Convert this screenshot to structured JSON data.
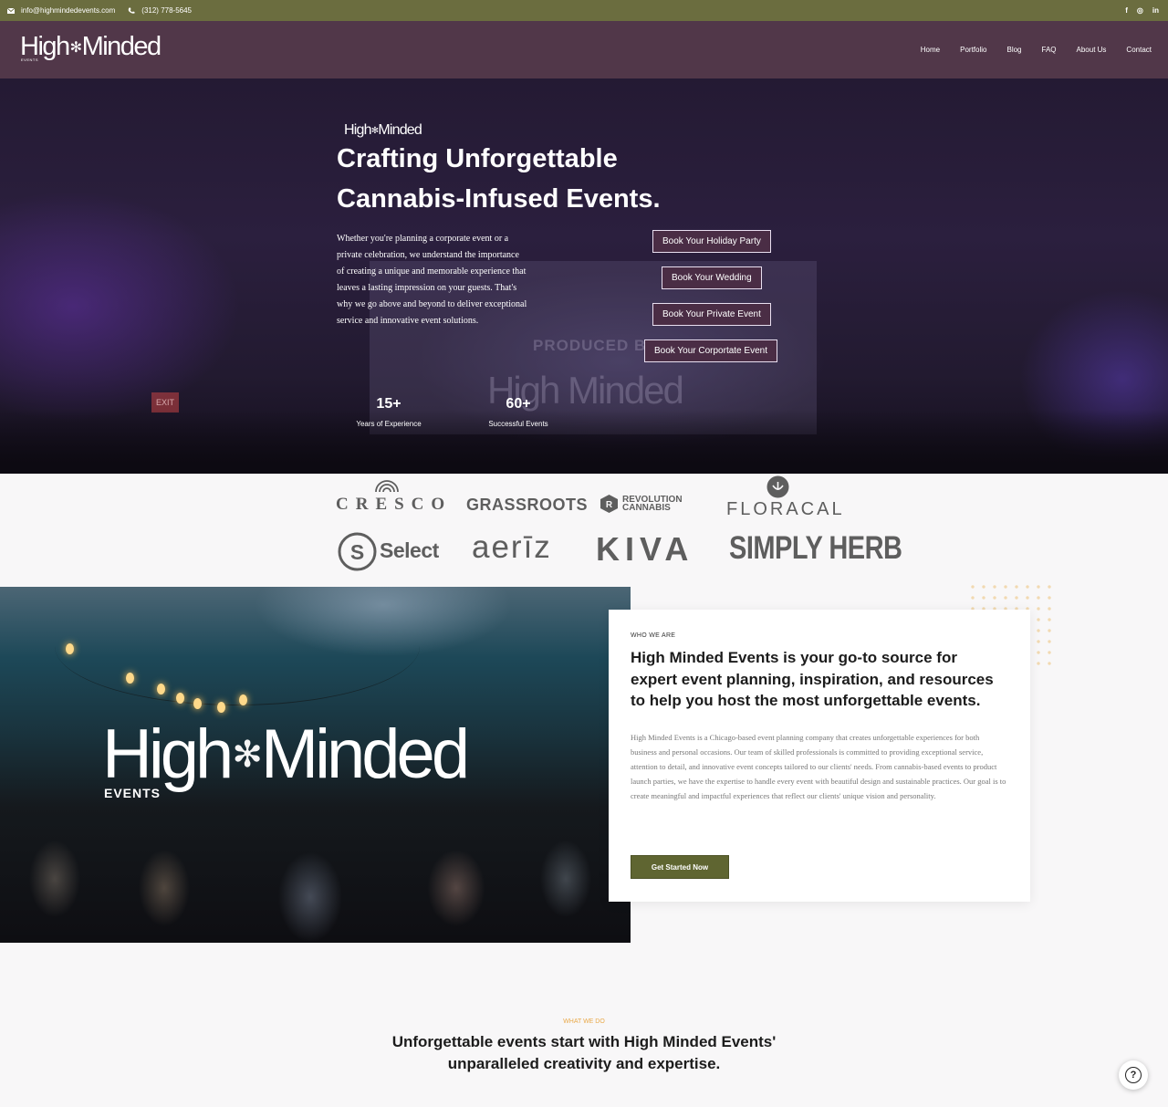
{
  "topbar": {
    "email": "info@highmindedevents.com",
    "phone": "(312) 778-5645",
    "social": [
      "f",
      "◎",
      "in"
    ]
  },
  "header": {
    "logo_text_left": "High",
    "logo_text_right": "Minded",
    "logo_sub": "EVENTS",
    "nav": [
      "Home",
      "Portfolio",
      "Blog",
      "FAQ",
      "About Us",
      "Contact"
    ]
  },
  "hero": {
    "logo_left": "High",
    "logo_right": "Minded",
    "title": "Crafting Unforgettable Cannabis-Infused Events.",
    "description": "Whether you're planning a corporate event or a private celebration, we understand the importance of creating a unique and memorable experience that leaves a lasting impression on your guests. That's why we go above and beyond to deliver exceptional service and innovative event solutions.",
    "buttons": [
      "Book Your Holiday Party",
      "Book Your Wedding",
      "Book Your Private Event",
      "Book Your Corportate Event"
    ],
    "stats": [
      {
        "value": "15+",
        "label": "Years of Experience"
      },
      {
        "value": "60+",
        "label": "Successful Events"
      }
    ],
    "background_text_1": "PRODUCED B",
    "background_text_2": "High Minded",
    "exit_sign": "EXIT"
  },
  "brands": [
    "CRESCO",
    "GRASSROOTS",
    "REVOLUTION",
    "CANNABIS",
    "FLORACAL",
    "Select",
    "aerīz",
    "KIVA",
    "SIMPLY HERB"
  ],
  "about": {
    "photo_logo_left": "High",
    "photo_logo_right": "Minded",
    "photo_logo_sub": "EVENTS",
    "eyebrow": "WHO WE ARE",
    "heading": "High Minded Events is your go-to source for expert event planning, inspiration, and resources to help you host the most unforgettable events.",
    "body": "High Minded Events is a Chicago-based event planning company that creates unforgettable experiences for both business and personal occasions. Our team of skilled professionals is committed to providing exceptional service, attention to detail, and innovative event concepts tailored to our clients' needs. From cannabis-based events to product launch parties, we have the expertise to handle every event with beautiful design and sustainable practices. Our goal is to create meaningful and impactful experiences that reflect our clients' unique vision and personality.",
    "cta": "Get Started Now"
  },
  "what_we_do": {
    "eyebrow": "WHAT WE DO",
    "title_line1": "Unforgettable events start with High Minded Events'",
    "title_line2": "unparalleled creativity and expertise."
  },
  "colors": {
    "topbar": "#6b6d3f",
    "header": "#513749",
    "accent_orange": "#e9a94a",
    "cta_green": "#5f6531"
  }
}
